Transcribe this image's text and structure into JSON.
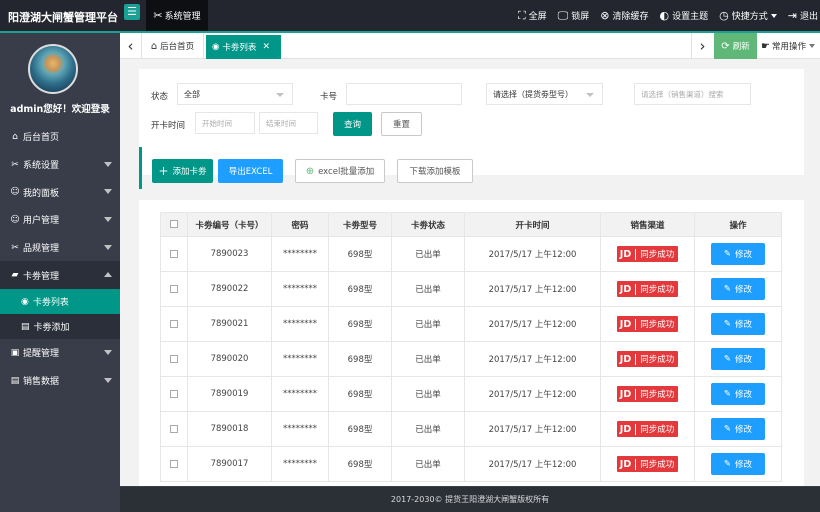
{
  "app": {
    "title": "阳澄湖大闸蟹管理平台",
    "top_nav": "系统管理"
  },
  "topbar": {
    "items": [
      {
        "label": "全屏",
        "icon": "fullscreen-icon",
        "glyph": "⛶"
      },
      {
        "label": "锁屏",
        "icon": "monitor-icon",
        "glyph": "🖵"
      },
      {
        "label": "清除缓存",
        "icon": "clear-cache-icon",
        "glyph": "⊗"
      },
      {
        "label": "设置主题",
        "icon": "palette-icon",
        "glyph": "◐"
      },
      {
        "label": "快捷方式",
        "icon": "clock-icon",
        "glyph": "◷"
      },
      {
        "label": "退出",
        "icon": "logout-icon",
        "glyph": "⇥"
      }
    ]
  },
  "sidebar": {
    "welcome": "admin您好！欢迎登录",
    "items": [
      {
        "label": "后台首页",
        "glyph": "⌂"
      },
      {
        "label": "系统设置",
        "glyph": "✂"
      },
      {
        "label": "我的面板",
        "glyph": "☺"
      },
      {
        "label": "用户管理",
        "glyph": "☺"
      },
      {
        "label": "品规管理",
        "glyph": "✂"
      },
      {
        "label": "卡劵管理",
        "glyph": "▰"
      },
      {
        "label": "卡劵列表",
        "glyph": "◉"
      },
      {
        "label": "卡劵添加",
        "glyph": "▤"
      },
      {
        "label": "提醒管理",
        "glyph": "▣"
      },
      {
        "label": "销售数据",
        "glyph": "▤"
      }
    ]
  },
  "tabs": {
    "home": "后台首页",
    "current": "卡劵列表",
    "refresh": "刷新",
    "common_ops": "常用操作"
  },
  "filter": {
    "status_label": "状态",
    "status_value": "全部",
    "card_no_label": "卡号",
    "card_no_value": "",
    "card_type_placeholder": "请选择（提货劵型号）",
    "channel_placeholder": "请选择（销售渠道）搜索",
    "open_time_label": "开卡时间",
    "start_placeholder": "开始时间",
    "end_placeholder": "结束时间",
    "query_btn": "查询",
    "reset_btn": "重置"
  },
  "toolbar": {
    "add_card": "添加卡劵",
    "export_excel": "导出EXCEL",
    "excel_batch": "excel批量添加",
    "download_template": "下载添加模板"
  },
  "table": {
    "headers": [
      "卡劵编号（卡号）",
      "密码",
      "卡劵型号",
      "卡劵状态",
      "开卡时间",
      "销售渠道",
      "操作"
    ],
    "rows": [
      {
        "card_no": "7890023",
        "password": "********",
        "model": "698型",
        "status": "已出单",
        "open_time": "2017/5/17 上午12:00",
        "channel_logo": "JD",
        "channel": "同步成功",
        "action": "修改"
      },
      {
        "card_no": "7890022",
        "password": "********",
        "model": "698型",
        "status": "已出单",
        "open_time": "2017/5/17 上午12:00",
        "channel_logo": "JD",
        "channel": "同步成功",
        "action": "修改"
      },
      {
        "card_no": "7890021",
        "password": "********",
        "model": "698型",
        "status": "已出单",
        "open_time": "2017/5/17 上午12:00",
        "channel_logo": "JD",
        "channel": "同步成功",
        "action": "修改"
      },
      {
        "card_no": "7890020",
        "password": "********",
        "model": "698型",
        "status": "已出单",
        "open_time": "2017/5/17 上午12:00",
        "channel_logo": "JD",
        "channel": "同步成功",
        "action": "修改"
      },
      {
        "card_no": "7890019",
        "password": "********",
        "model": "698型",
        "status": "已出单",
        "open_time": "2017/5/17 上午12:00",
        "channel_logo": "JD",
        "channel": "同步成功",
        "action": "修改"
      },
      {
        "card_no": "7890018",
        "password": "********",
        "model": "698型",
        "status": "已出单",
        "open_time": "2017/5/17 上午12:00",
        "channel_logo": "JD",
        "channel": "同步成功",
        "action": "修改"
      },
      {
        "card_no": "7890017",
        "password": "********",
        "model": "698型",
        "status": "已出单",
        "open_time": "2017/5/17 上午12:00",
        "channel_logo": "JD",
        "channel": "同步成功",
        "action": "修改"
      }
    ]
  },
  "footer": {
    "text": "2017-2030© 提货王阳澄湖大闸蟹版权所有"
  },
  "colors": {
    "primary": "#009688",
    "blue": "#1e9fff",
    "green": "#5fb878",
    "jd_red": "#e4393c",
    "sidebar": "#393d49",
    "topbar": "#23262e"
  }
}
